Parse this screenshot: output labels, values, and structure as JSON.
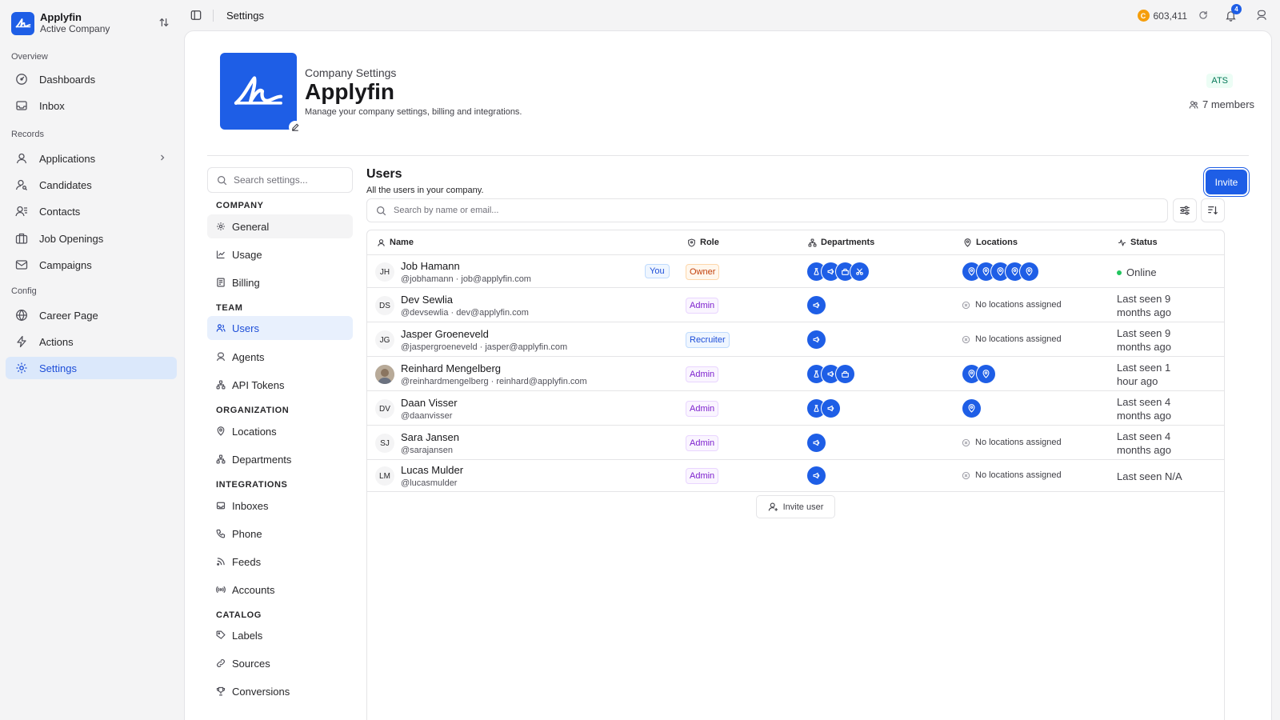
{
  "brand": {
    "name": "Applyfin",
    "subtitle": "Active Company"
  },
  "sidebar": {
    "sections": {
      "overview": "Overview",
      "records": "Records",
      "config": "Config"
    },
    "items": [
      {
        "label": "Dashboards",
        "icon": "dashboard-gauge-icon"
      },
      {
        "label": "Inbox",
        "icon": "inbox-icon"
      },
      {
        "label": "Applications",
        "icon": "user-icon"
      },
      {
        "label": "Candidates",
        "icon": "user-search-icon"
      },
      {
        "label": "Contacts",
        "icon": "contacts-icon"
      },
      {
        "label": "Job Openings",
        "icon": "briefcase-icon"
      },
      {
        "label": "Campaigns",
        "icon": "mail-icon"
      },
      {
        "label": "Career Page",
        "icon": "globe-icon"
      },
      {
        "label": "Actions",
        "icon": "lightning-icon"
      },
      {
        "label": "Settings",
        "icon": "gear-icon",
        "active": true
      }
    ]
  },
  "topbar": {
    "title": "Settings",
    "credits": "603,411",
    "coin_letter": "C",
    "notifications": "4"
  },
  "company": {
    "eyebrow": "Company Settings",
    "name": "Applyfin",
    "description": "Manage your company settings, billing and integrations.",
    "badge": "ATS",
    "members": "7 members"
  },
  "settings_nav": {
    "search_placeholder": "Search settings...",
    "sections": {
      "company": "COMPANY",
      "team": "TEAM",
      "organization": "ORGANIZATION",
      "integrations": "INTEGRATIONS",
      "catalog": "CATALOG"
    },
    "items": {
      "general": "General",
      "usage": "Usage",
      "billing": "Billing",
      "users": "Users",
      "agents": "Agents",
      "api_tokens": "API Tokens",
      "locations": "Locations",
      "departments": "Departments",
      "inboxes": "Inboxes",
      "phone": "Phone",
      "feeds": "Feeds",
      "accounts": "Accounts",
      "labels": "Labels",
      "sources": "Sources",
      "conversions": "Conversions"
    }
  },
  "users": {
    "title": "Users",
    "subtitle": "All the users in your company.",
    "invite_label": "Invite",
    "search_placeholder": "Search by name or email...",
    "columns": {
      "name": "Name",
      "role": "Role",
      "departments": "Departments",
      "locations": "Locations",
      "status": "Status"
    },
    "you_label": "You",
    "no_locations": "No locations assigned",
    "invite_user_label": "Invite user",
    "rows": [
      {
        "initials": "JH",
        "name": "Job Hamann",
        "handle": "@jobhamann · job@applyfin.com",
        "you": true,
        "role": "Owner",
        "departments": 4,
        "locations": 5,
        "status": "Online",
        "online": true
      },
      {
        "initials": "DS",
        "name": "Dev Sewlia",
        "handle": "@devsewlia · dev@applyfin.com",
        "role": "Admin",
        "departments": 1,
        "locations": 0,
        "status": "Last seen 9 months ago"
      },
      {
        "initials": "JG",
        "name": "Jasper Groeneveld",
        "handle": "@jaspergroeneveld · jasper@applyfin.com",
        "role": "Recruiter",
        "departments": 1,
        "locations": 0,
        "status": "Last seen 9 months ago"
      },
      {
        "initials": "",
        "name": "Reinhard Mengelberg",
        "handle": "@reinhardmengelberg · reinhard@applyfin.com",
        "role": "Admin",
        "departments": 3,
        "locations": 2,
        "status": "Last seen 1 hour ago",
        "photo": true
      },
      {
        "initials": "DV",
        "name": "Daan Visser",
        "handle": "@daanvisser",
        "role": "Admin",
        "departments": 2,
        "locations": 1,
        "status": "Last seen 4 months ago"
      },
      {
        "initials": "SJ",
        "name": "Sara Jansen",
        "handle": "@sarajansen",
        "role": "Admin",
        "departments": 1,
        "locations": 0,
        "status": "Last seen 4 months ago"
      },
      {
        "initials": "LM",
        "name": "Lucas Mulder",
        "handle": "@lucasmulder",
        "role": "Admin",
        "departments": 1,
        "locations": 0,
        "status": "Last seen N/A"
      }
    ]
  }
}
